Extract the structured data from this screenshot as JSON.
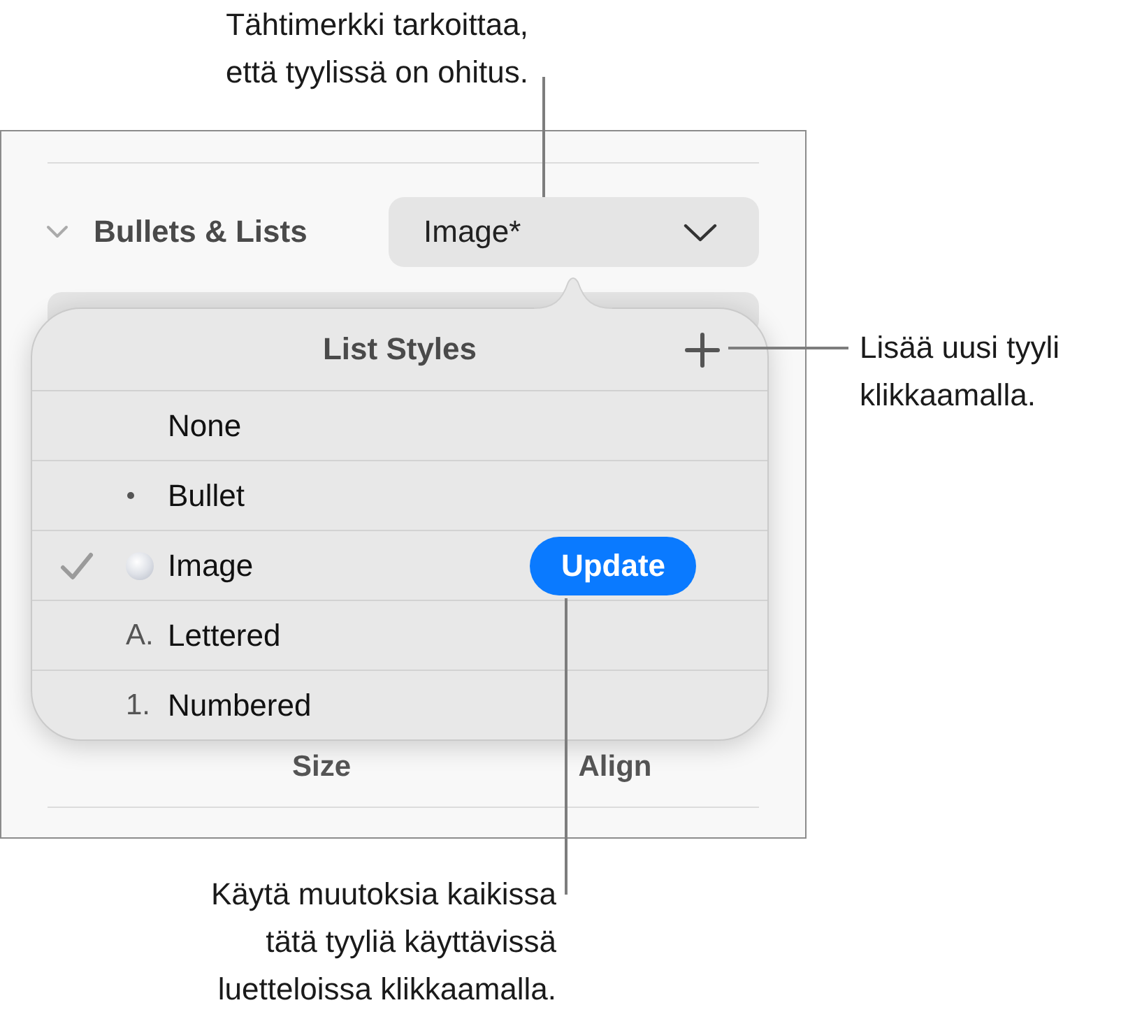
{
  "callouts": [
    {
      "kind": "top",
      "text": "Tähtimerkki tarkoittaa,\nettä tyylissä on ohitus."
    },
    {
      "kind": "right",
      "text": "Lisää uusi tyyli\nklikkaamalla."
    },
    {
      "kind": "bottom",
      "text": "Käytä muutoksia kaikissa\ntätä tyyliä käyttävissä\nluetteloissa klikkaamalla."
    }
  ],
  "inspector": {
    "section": {
      "title": "Bullets & Lists",
      "expanded": true
    },
    "style_popup": {
      "value": "Image*"
    },
    "labels": [
      "Size",
      "Align"
    ]
  },
  "popover": {
    "title": "List Styles",
    "styles": [
      {
        "label": "None",
        "kind": "plain",
        "selected": false
      },
      {
        "label": "Bullet",
        "kind": "dot",
        "selected": false
      },
      {
        "label": "Image",
        "kind": "image",
        "selected": true,
        "action": "Update"
      },
      {
        "label": "Lettered",
        "kind": "text",
        "marker": "A.",
        "selected": false
      },
      {
        "label": "Numbered",
        "kind": "text",
        "marker": "1.",
        "selected": false
      }
    ]
  }
}
